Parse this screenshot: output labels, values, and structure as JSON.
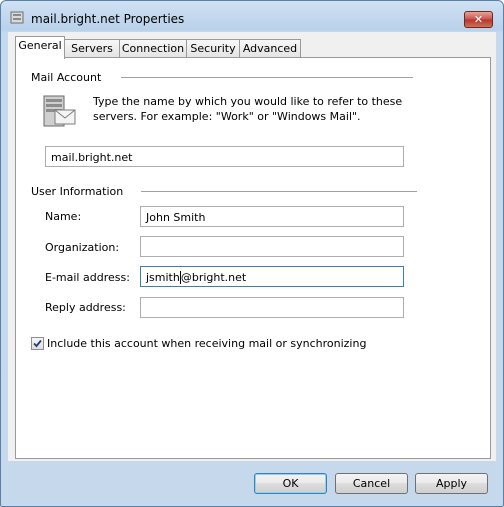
{
  "window": {
    "title": "mail.bright.net Properties"
  },
  "tabs": [
    {
      "label": "General",
      "active": true
    },
    {
      "label": "Servers"
    },
    {
      "label": "Connection"
    },
    {
      "label": "Security"
    },
    {
      "label": "Advanced"
    }
  ],
  "mail_account": {
    "heading": "Mail Account",
    "description": "Type the name by which you would like to refer to these servers.  For example: \"Work\" or \"Windows Mail\".",
    "account_name": "mail.bright.net"
  },
  "user_info": {
    "heading": "User Information",
    "name_label": "Name:",
    "name_value": "John Smith",
    "organization_label": "Organization:",
    "organization_value": "",
    "email_label": "E-mail address:",
    "email_value_before_caret": "jsmith",
    "email_value_after_caret": "@bright.net",
    "reply_label": "Reply address:",
    "reply_value": ""
  },
  "include_checkbox": {
    "label": "Include this account when receiving mail or synchronizing",
    "checked": true
  },
  "buttons": {
    "ok": "OK",
    "cancel": "Cancel",
    "apply": "Apply"
  }
}
